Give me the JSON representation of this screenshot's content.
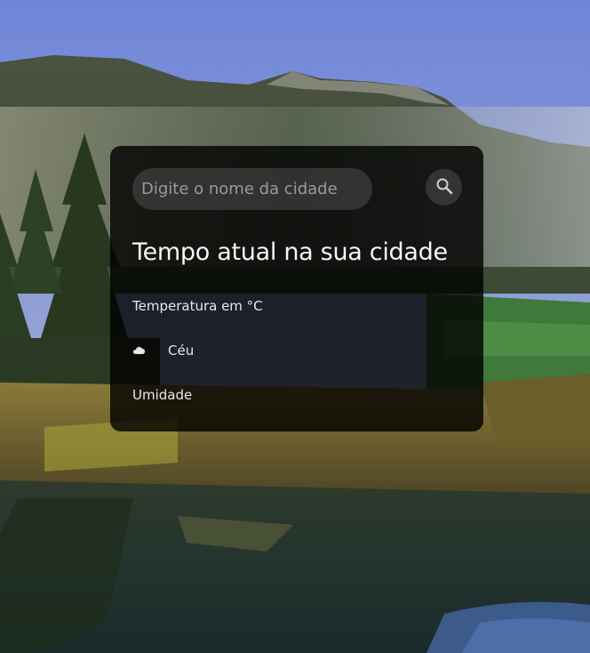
{
  "search": {
    "placeholder": "Digite o nome da cidade",
    "icon": "search-icon"
  },
  "weather": {
    "title": "Tempo atual na sua cidade",
    "temperature_label": "Temperatura em °C",
    "sky_icon": "cloud-icon",
    "sky_label": "Céu",
    "humidity_label": "Umidade"
  }
}
